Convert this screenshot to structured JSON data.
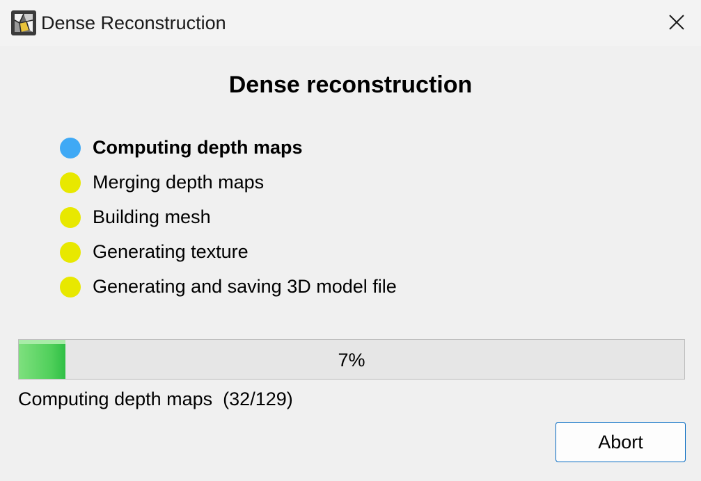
{
  "window": {
    "title": "Dense Reconstruction",
    "app_icon": "photogrammetry-app-icon",
    "close_icon": "close-icon"
  },
  "dialog": {
    "heading": "Dense reconstruction"
  },
  "steps": [
    {
      "label": "Computing depth maps",
      "state": "active",
      "color": "#3fa9f5"
    },
    {
      "label": "Merging depth maps",
      "state": "pending",
      "color": "#e8e800"
    },
    {
      "label": "Building mesh",
      "state": "pending",
      "color": "#e8e800"
    },
    {
      "label": "Generating texture",
      "state": "pending",
      "color": "#e8e800"
    },
    {
      "label": "Generating and saving 3D model file",
      "state": "pending",
      "color": "#e8e800"
    }
  ],
  "progress": {
    "percent": 7,
    "text": "7%",
    "status": "Computing depth maps  (32/129)"
  },
  "buttons": {
    "abort": "Abort"
  },
  "colors": {
    "active_step": "#3fa9f5",
    "pending_step": "#e8e800",
    "progress_fill": "#4fcf5a",
    "button_border": "#0067c0"
  }
}
